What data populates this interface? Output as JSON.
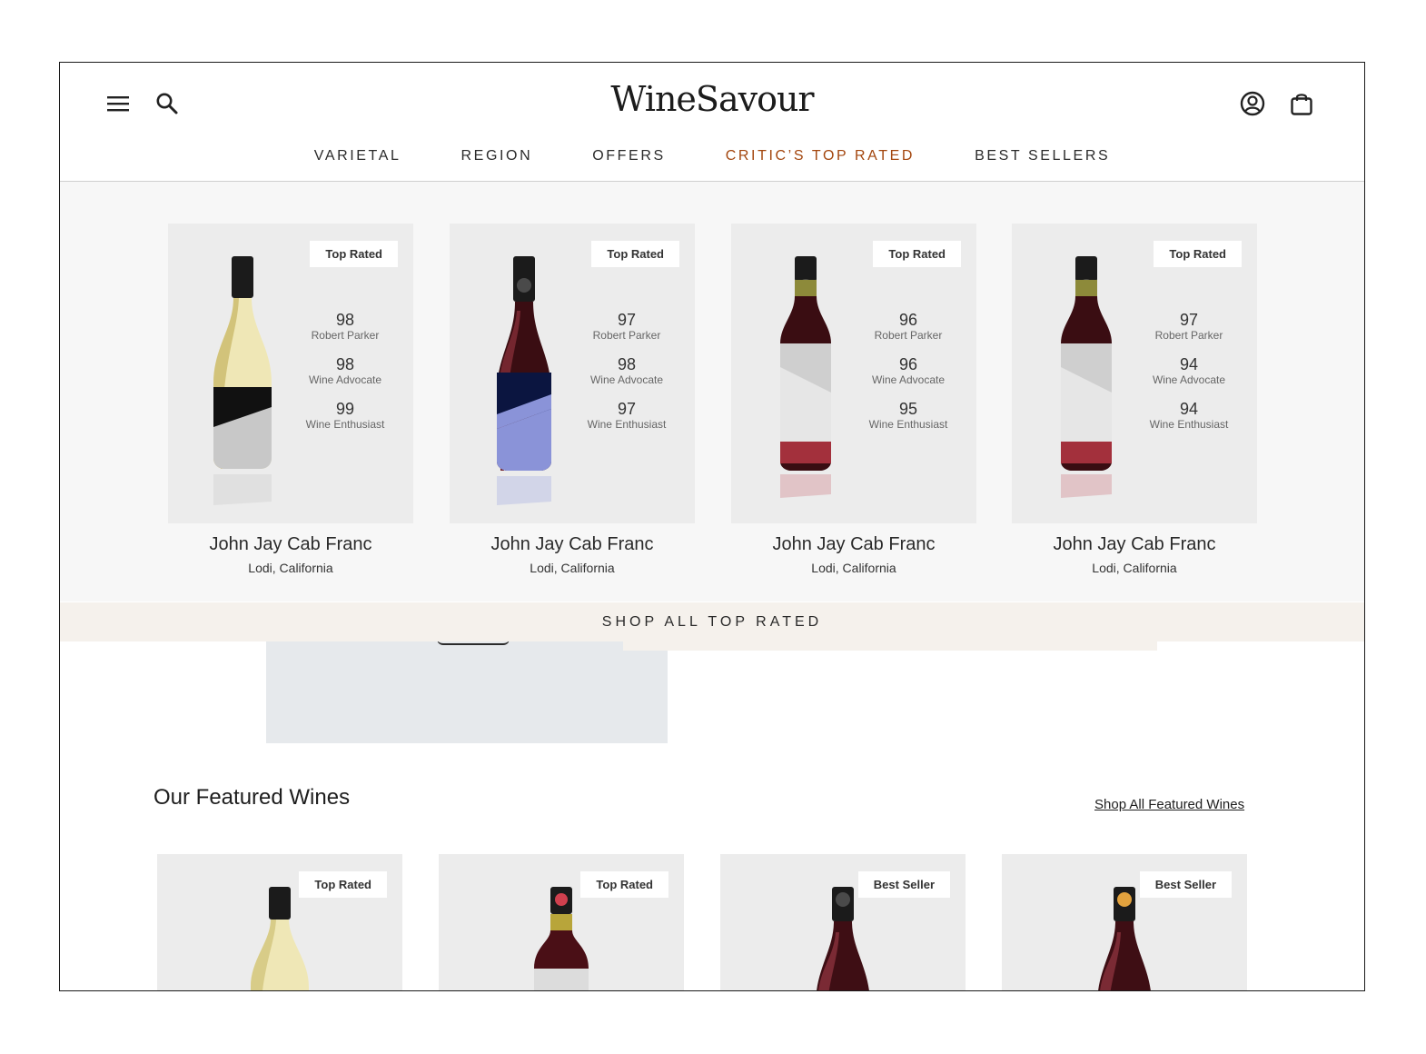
{
  "brand": {
    "logo": "WineSavour"
  },
  "header": {
    "menu_icon": "hamburger-menu-icon",
    "search_icon": "search-icon",
    "account_icon": "user-circle-icon",
    "bag_icon": "shopping-bag-icon"
  },
  "nav": {
    "items": [
      {
        "label": "VARIETAL"
      },
      {
        "label": "REGION"
      },
      {
        "label": "OFFERS"
      },
      {
        "label": "CRITIC’S TOP RATED",
        "active": true
      },
      {
        "label": "BEST SELLERS"
      }
    ],
    "active_color": "#a3460e"
  },
  "top_rated": {
    "cards": [
      {
        "badge": "Top Rated",
        "name": "John Jay Cab Franc",
        "location": "Lodi, California",
        "bottle": "white-wine-black-silver-label",
        "ratings": [
          {
            "score": "98",
            "critic": "Robert Parker"
          },
          {
            "score": "98",
            "critic": "Wine Advocate"
          },
          {
            "score": "99",
            "critic": "Wine Enthusiast"
          }
        ]
      },
      {
        "badge": "Top Rated",
        "name": "John Jay Cab Franc",
        "location": "Lodi, California",
        "bottle": "red-wine-navy-blue-label",
        "ratings": [
          {
            "score": "97",
            "critic": "Robert Parker"
          },
          {
            "score": "98",
            "critic": "Wine Advocate"
          },
          {
            "score": "97",
            "critic": "Wine Enthusiast"
          }
        ]
      },
      {
        "badge": "Top Rated",
        "name": "John Jay Cab Franc",
        "location": "Lodi, California",
        "bottle": "red-wine-white-red-label",
        "ratings": [
          {
            "score": "96",
            "critic": "Robert Parker"
          },
          {
            "score": "96",
            "critic": "Wine Advocate"
          },
          {
            "score": "95",
            "critic": "Wine Enthusiast"
          }
        ]
      },
      {
        "badge": "Top Rated",
        "name": "John Jay Cab Franc",
        "location": "Lodi, California",
        "bottle": "red-wine-white-red-label",
        "ratings": [
          {
            "score": "97",
            "critic": "Robert Parker"
          },
          {
            "score": "94",
            "critic": "Wine Advocate"
          },
          {
            "score": "94",
            "critic": "Wine Enthusiast"
          }
        ]
      }
    ],
    "shop_all": "SHOP ALL TOP RATED"
  },
  "featured": {
    "title": "Our Featured Wines",
    "link": "Shop All Featured Wines",
    "cards": [
      {
        "badge": "Top Rated"
      },
      {
        "badge": "Top Rated"
      },
      {
        "badge": "Best Seller"
      },
      {
        "badge": "Best Seller"
      }
    ]
  }
}
